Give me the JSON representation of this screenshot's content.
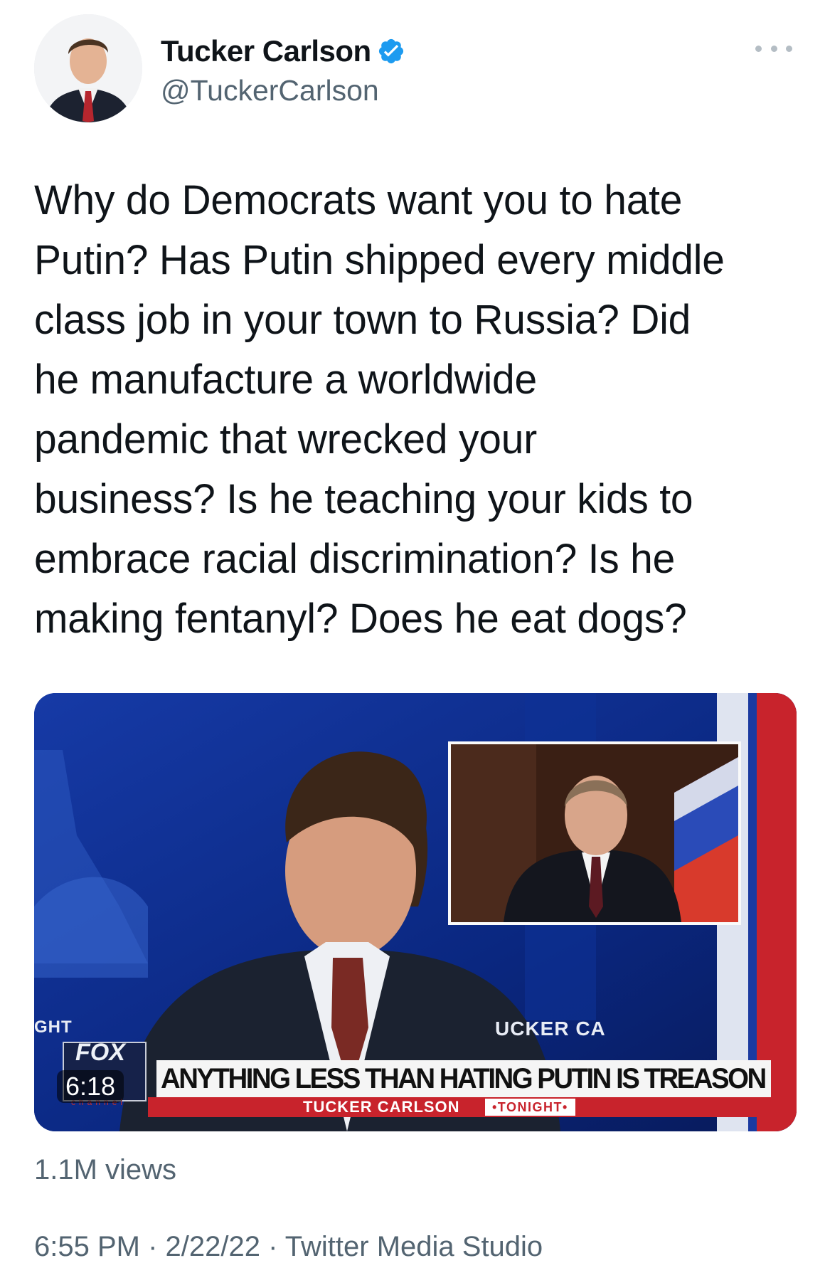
{
  "author": {
    "display_name": "Tucker Carlson",
    "handle": "@TuckerCarlson",
    "verified_icon": "verified-badge-icon",
    "avatar_icon": "profile-photo"
  },
  "menu": {
    "more_icon": "more-options-icon"
  },
  "tweet": {
    "lines": [
      "Why do Democrats want you to hate",
      "Putin? Has Putin shipped every middle",
      "class job in your town to Russia? Did",
      "he manufacture a worldwide",
      "pandemic that wrecked your",
      "business? Is he teaching your kids to",
      "embrace racial discrimination? Is he",
      "making fentanyl? Does he eat dogs?"
    ]
  },
  "video": {
    "duration": "6:18",
    "chyron": "ANYTHING LESS THAN HATING PUTIN IS TREASON",
    "show_name": "TUCKER CARLSON",
    "show_tag": "•TONIGHT•",
    "logo_text": "FOX",
    "logo_subtext": "channel",
    "partial_left": "GHT",
    "partial_right": "UCKER CA",
    "colors": {
      "blue": "#0b2a8c",
      "red": "#c8232c"
    }
  },
  "stats": {
    "views": "1.1M views"
  },
  "footer": {
    "timestamp": "6:55 PM · 2/22/22 · Twitter Media Studio"
  }
}
